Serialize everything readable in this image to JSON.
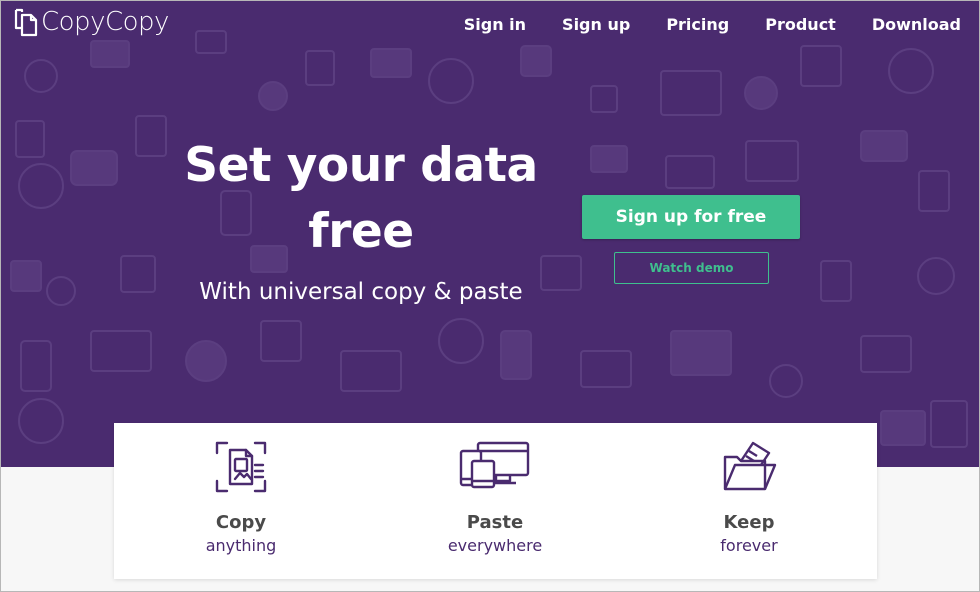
{
  "brand": {
    "name": "CopyCopy"
  },
  "nav": {
    "items": [
      {
        "label": "Sign in"
      },
      {
        "label": "Sign up"
      },
      {
        "label": "Pricing"
      },
      {
        "label": "Product"
      },
      {
        "label": "Download"
      }
    ]
  },
  "hero": {
    "headline_line1": "Set your data",
    "headline_line2": "free",
    "subhead": "With universal copy & paste",
    "primary_cta": "Sign up for free",
    "secondary_cta": "Watch demo"
  },
  "features": [
    {
      "title": "Copy",
      "subtitle": "anything",
      "icon": "scan-document-icon"
    },
    {
      "title": "Paste",
      "subtitle": "everywhere",
      "icon": "devices-icon"
    },
    {
      "title": "Keep",
      "subtitle": "forever",
      "icon": "folder-icon"
    }
  ],
  "colors": {
    "hero_bg": "#4a2b6f",
    "accent": "#3fbf8e",
    "feature_text": "#4a2b6f"
  }
}
